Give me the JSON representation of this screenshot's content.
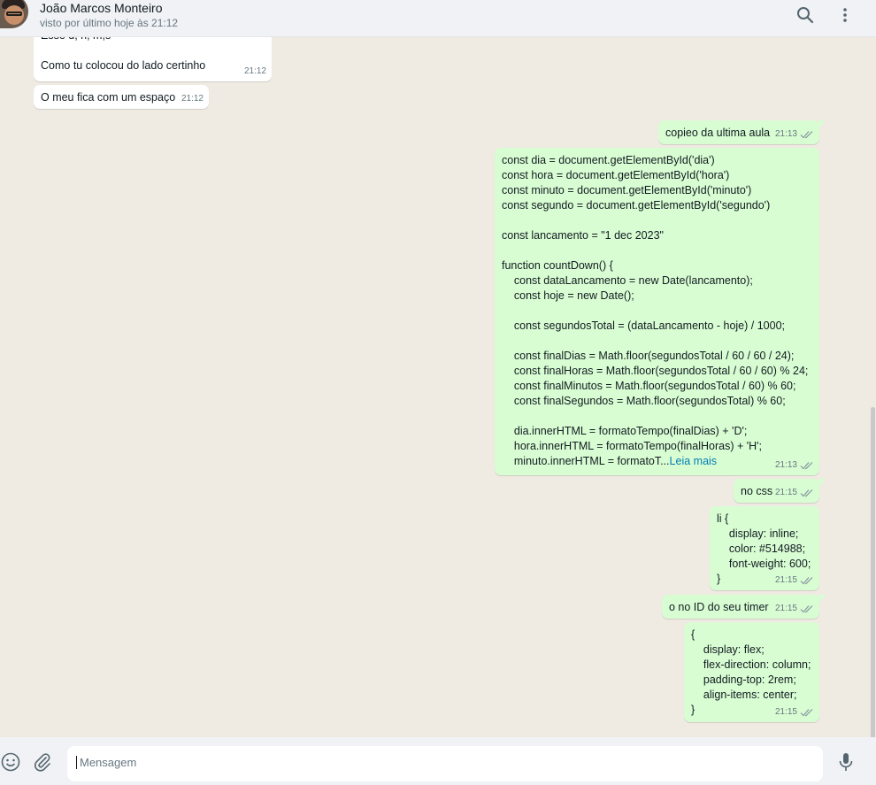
{
  "header": {
    "contact_name": "João Marcos Monteiro",
    "status": "visto por último hoje às 21:12",
    "search_icon": "search-icon",
    "menu_icon": "kebab-menu-icon"
  },
  "messages": [
    {
      "dir": "in",
      "text": "Esse d, h, m,s\n\nComo tu colocou do lado certinho",
      "time": "21:12"
    },
    {
      "dir": "in",
      "text": "O meu fica com um espaço",
      "time": "21:12"
    },
    {
      "dir": "out",
      "text": "copieo da ultima aula",
      "time": "21:13"
    },
    {
      "dir": "out",
      "text": "const dia = document.getElementById('dia')\nconst hora = document.getElementById('hora')\nconst minuto = document.getElementById('minuto')\nconst segundo = document.getElementById('segundo')\n\nconst lancamento = \"1 dec 2023\"\n\nfunction countDown() {\n    const dataLancamento = new Date(lancamento);\n    const hoje = new Date();\n\n    const segundosTotal = (dataLancamento - hoje) / 1000;\n\n    const finalDias = Math.floor(segundosTotal / 60 / 60 / 24);\n    const finalHoras = Math.floor(segundosTotal / 60 / 60) % 24;\n    const finalMinutos = Math.floor(segundosTotal / 60) % 60;\n    const finalSegundos = Math.floor(segundosTotal) % 60;\n\n    dia.innerHTML = formatoTempo(finalDias) + 'D';\n    hora.innerHTML = formatoTempo(finalHoras) + 'H';\n    minuto.innerHTML = formatoT...",
      "read_more": "Leia mais",
      "time": "21:13"
    },
    {
      "dir": "out",
      "text": "no css",
      "time": "21:15"
    },
    {
      "dir": "out",
      "text": "li {\n    display: inline;\n    color: #514988;\n    font-weight: 600;\n}",
      "time": "21:15"
    },
    {
      "dir": "out",
      "text": "o no ID do seu timer",
      "time": "21:15"
    },
    {
      "dir": "out",
      "text": "{\n    display: flex;\n    flex-direction: column;\n    padding-top: 2rem;\n    align-items: center;\n}",
      "time": "21:15"
    }
  ],
  "composer": {
    "placeholder": "Mensagem",
    "emoji_icon": "emoji-icon",
    "attach_icon": "paperclip-icon",
    "mic_icon": "microphone-icon"
  },
  "colors": {
    "incoming_bubble": "#ffffff",
    "outgoing_bubble": "#d9fdd3",
    "chat_background": "#efeae2",
    "read_more_link": "#027eb5"
  }
}
